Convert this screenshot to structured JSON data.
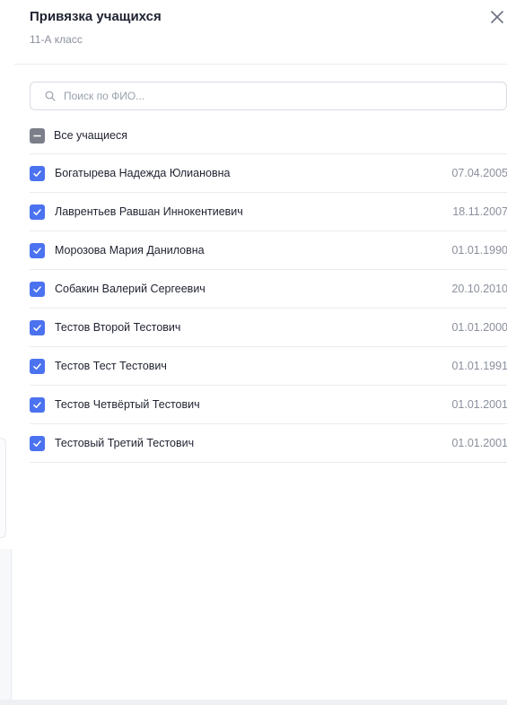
{
  "header": {
    "title": "Привязка учащихся",
    "subtitle": "11-А класс"
  },
  "search": {
    "placeholder": "Поиск по ФИО...",
    "value": ""
  },
  "select_all": {
    "label": "Все учащиеся",
    "state": "indeterminate"
  },
  "students": [
    {
      "name": "Богатырева Надежда Юлиановна",
      "date": "07.04.2005",
      "checked": true
    },
    {
      "name": "Лаврентьев Равшан Иннокентиевич",
      "date": "18.11.2007",
      "checked": true
    },
    {
      "name": "Морозова Мария Даниловна",
      "date": "01.01.1990",
      "checked": true
    },
    {
      "name": "Собакин Валерий Сергеевич",
      "date": "20.10.2010",
      "checked": true
    },
    {
      "name": "Тестов Второй Тестович",
      "date": "01.01.2000",
      "checked": true
    },
    {
      "name": "Тестов Тест Тестович",
      "date": "01.01.1991",
      "checked": true
    },
    {
      "name": "Тестов Четвёртый Тестович",
      "date": "01.01.2001",
      "checked": true
    },
    {
      "name": "Тестовый Третий Тестович",
      "date": "01.01.2001",
      "checked": true
    }
  ],
  "colors": {
    "checkbox_checked": "#4b72ef",
    "checkbox_indeterminate": "#7c7f8a",
    "text_primary": "#1f2230",
    "text_secondary": "#8a8f9c",
    "divider": "#e9ebf0"
  },
  "icons": {
    "close": "close-icon",
    "search": "search-icon",
    "check": "check-icon",
    "minus": "minus-icon"
  }
}
